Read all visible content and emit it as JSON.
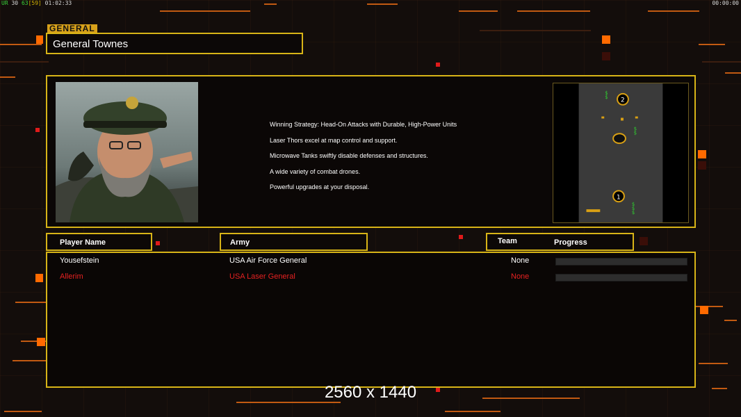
{
  "status_bar": {
    "prefix": "UR",
    "fps_a": "30",
    "fps_b": "63",
    "fps_c": "[59]",
    "elapsed": "01:02:33",
    "clock": "00:00:00"
  },
  "general": {
    "tag": "GENERAL",
    "name": "General Townes"
  },
  "briefing": {
    "lines": [
      "Winning Strategy: Head-On Attacks with Durable, High-Power Units",
      "Laser Thors excel at map control and support.",
      "Microwave Tanks swiftly disable defenses and structures.",
      "A wide variety of combat drones.",
      "Powerful upgrades at your disposal."
    ]
  },
  "minimap": {
    "start_positions": [
      "2",
      "1"
    ]
  },
  "roster": {
    "headers": {
      "player": "Player Name",
      "army": "Army",
      "team": "Team",
      "progress": "Progress"
    },
    "players": [
      {
        "name": "Yousefstein",
        "army": "USA Air Force General",
        "team": "None",
        "color": "#ffffff",
        "progress": 0
      },
      {
        "name": "Allerim",
        "army": "USA Laser General",
        "team": "None",
        "color": "#e52121",
        "progress": 0
      }
    ]
  },
  "overlay": {
    "resolution": "2560 x 1440"
  },
  "colors": {
    "border_gold": "#d8b417",
    "accent_orange": "#ff6a00",
    "enemy_red": "#e52121"
  }
}
